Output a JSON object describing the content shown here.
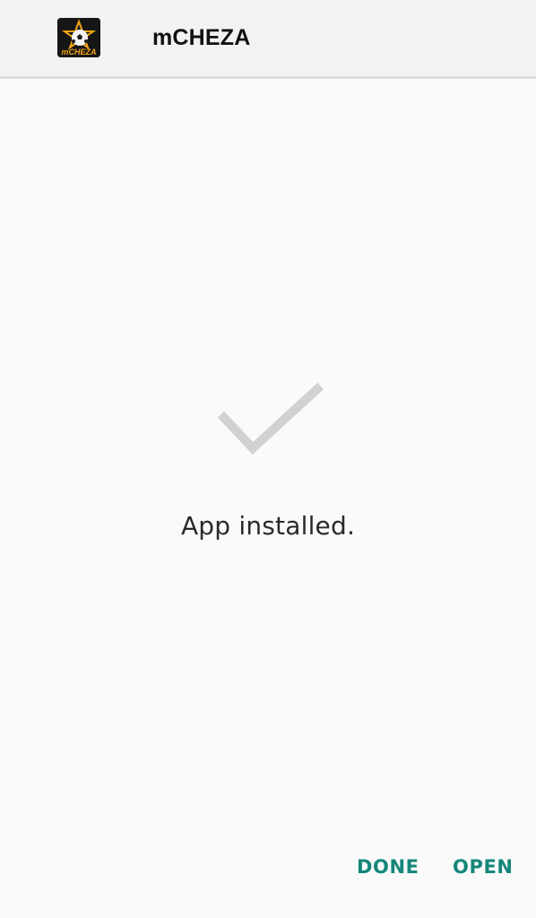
{
  "header": {
    "app_icon": "mcheza-app-icon",
    "app_icon_text": "mCHEZA",
    "app_name": "mCHEZA"
  },
  "status": {
    "icon": "checkmark-icon",
    "message": "App installed."
  },
  "actions": {
    "done_label": "DONE",
    "open_label": "OPEN"
  },
  "colors": {
    "background": "#fafafa",
    "header_background": "#f2f2f2",
    "accent": "#14877a",
    "checkmark": "#cfd1d3",
    "icon_brand": "#f2a516"
  }
}
